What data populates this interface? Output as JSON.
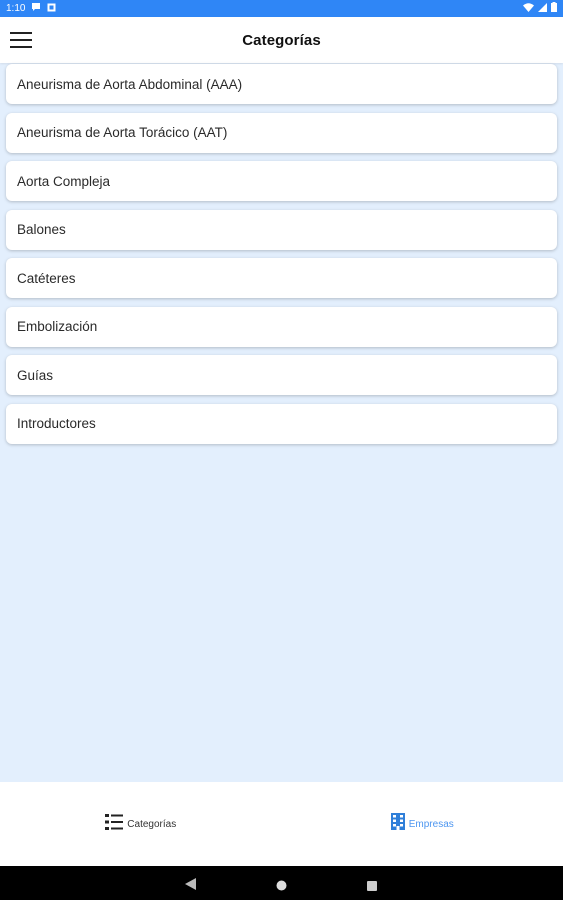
{
  "status_bar": {
    "time": "1:10",
    "icons_left": [
      "chat-bubble-icon",
      "photo-icon"
    ],
    "icons_right": [
      "wifi-icon",
      "signal-icon",
      "battery-icon"
    ],
    "color": "#2f86f6"
  },
  "app_bar": {
    "title": "Categorías",
    "menu_icon": "hamburger-menu-icon"
  },
  "categories": [
    {
      "label": "Aneurisma de Aorta Abdominal (AAA)"
    },
    {
      "label": "Aneurisma de Aorta Torácico (AAT)"
    },
    {
      "label": "Aorta Compleja"
    },
    {
      "label": "Balones"
    },
    {
      "label": "Catéteres"
    },
    {
      "label": "Embolización"
    },
    {
      "label": "Guías"
    },
    {
      "label": "Introductores"
    }
  ],
  "bottom_nav": {
    "items": [
      {
        "label": "Categorías",
        "icon": "list-icon",
        "color": "#333333"
      },
      {
        "label": "Empresas",
        "icon": "building-icon",
        "color": "#4d96f0"
      }
    ]
  },
  "system_nav": {
    "icons": [
      "back-icon",
      "home-icon",
      "recents-icon"
    ]
  },
  "colors": {
    "background": "#e3effd",
    "accent": "#4d96f0"
  }
}
